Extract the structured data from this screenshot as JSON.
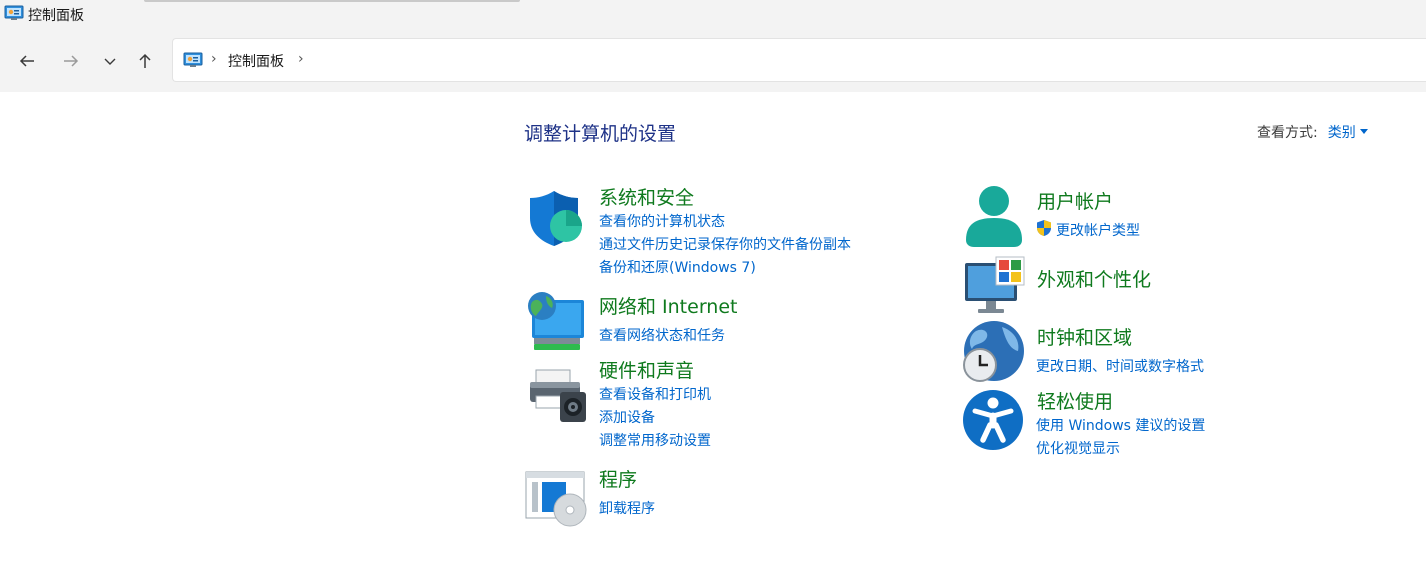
{
  "window": {
    "title": "控制面板"
  },
  "address": {
    "crumb": "控制面板"
  },
  "header": {
    "title": "调整计算机的设置",
    "view_by_label": "查看方式:",
    "view_by_value": "类别"
  },
  "categories": [
    {
      "title": "系统和安全",
      "icon": "shield-icon",
      "links": [
        "查看你的计算机状态",
        "通过文件历史记录保存你的文件备份副本",
        "备份和还原(Windows 7)"
      ]
    },
    {
      "title": "网络和 Internet",
      "icon": "network-globe-icon",
      "links": [
        "查看网络状态和任务"
      ]
    },
    {
      "title": "硬件和声音",
      "icon": "printer-speaker-icon",
      "links": [
        "查看设备和打印机",
        "添加设备",
        "调整常用移动设置"
      ]
    },
    {
      "title": "程序",
      "icon": "programs-disc-icon",
      "links": [
        "卸载程序"
      ]
    },
    {
      "title": "用户帐户",
      "icon": "user-account-icon",
      "links": [
        "更改帐户类型"
      ]
    },
    {
      "title": "外观和个性化",
      "icon": "monitor-palette-icon",
      "links": []
    },
    {
      "title": "时钟和区域",
      "icon": "globe-clock-icon",
      "links": [
        "更改日期、时间或数字格式"
      ]
    },
    {
      "title": "轻松使用",
      "icon": "accessibility-icon",
      "links": [
        "使用 Windows 建议的设置",
        "优化视觉显示"
      ]
    }
  ],
  "colors": {
    "category_title": "#0f7a1e",
    "link": "#0066cc",
    "heading": "#1e3287"
  }
}
